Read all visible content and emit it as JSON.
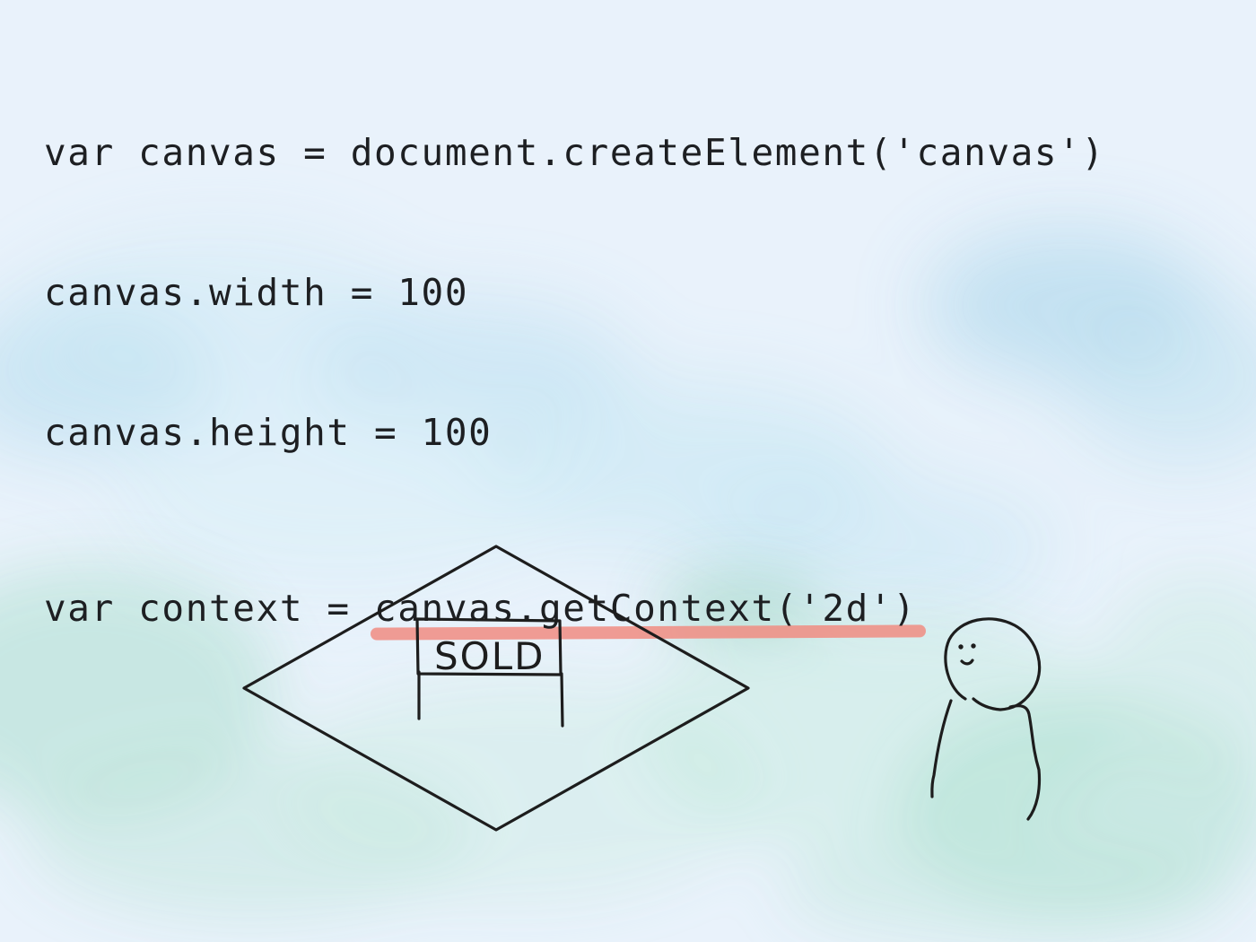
{
  "code": {
    "line1": "var canvas = document.createElement('canvas')",
    "line2": "canvas.width = 100",
    "line3": "canvas.height = 100",
    "line4_before": "var context = ",
    "line4_highlight": "canvas.getContext('2d')"
  },
  "illustration": {
    "sign_text": "SOLD"
  },
  "colors": {
    "background": "#e9f2fb",
    "highlight": "#f08d83",
    "ink": "#1d1d1d",
    "watercolor_blue": "#9fd0ea",
    "watercolor_green": "#8fd0b8"
  },
  "icons": {
    "property": "diamond-plot-icon",
    "sign": "sold-sign-icon",
    "person": "stick-person-icon"
  }
}
